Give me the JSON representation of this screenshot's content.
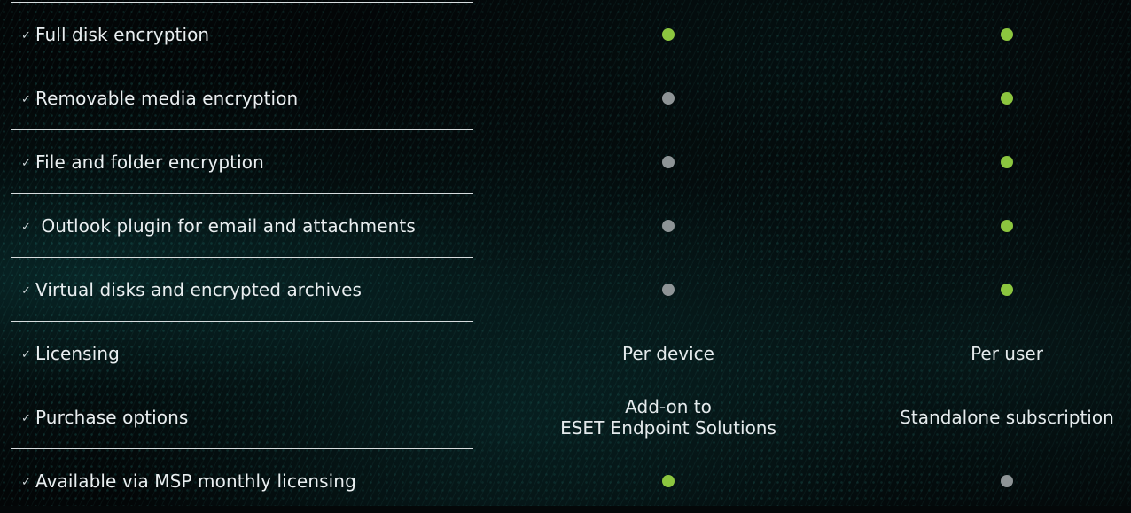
{
  "colors": {
    "included": "#8cc63f",
    "not_included": "#8e9496",
    "divider": "#d7dcde",
    "text": "#e9eef0"
  },
  "check_glyph": "✓",
  "rows": [
    {
      "feature": "Full disk encryption",
      "col1": {
        "type": "dot",
        "status": "included"
      },
      "col2": {
        "type": "dot",
        "status": "included"
      }
    },
    {
      "feature": "Removable media encryption",
      "col1": {
        "type": "dot",
        "status": "not_included"
      },
      "col2": {
        "type": "dot",
        "status": "included"
      }
    },
    {
      "feature": "File and folder encryption",
      "col1": {
        "type": "dot",
        "status": "not_included"
      },
      "col2": {
        "type": "dot",
        "status": "included"
      }
    },
    {
      "feature": " Outlook plugin for email and attachments",
      "col1": {
        "type": "dot",
        "status": "not_included"
      },
      "col2": {
        "type": "dot",
        "status": "included"
      }
    },
    {
      "feature": "Virtual disks and encrypted archives",
      "col1": {
        "type": "dot",
        "status": "not_included"
      },
      "col2": {
        "type": "dot",
        "status": "included"
      }
    },
    {
      "feature": "Licensing",
      "col1": {
        "type": "text",
        "lines": [
          "Per device"
        ]
      },
      "col2": {
        "type": "text",
        "lines": [
          "Per user"
        ]
      }
    },
    {
      "feature": "Purchase options",
      "col1": {
        "type": "text",
        "lines": [
          "Add-on to",
          "ESET Endpoint Solutions"
        ]
      },
      "col2": {
        "type": "text",
        "lines": [
          "Standalone subscription"
        ]
      }
    },
    {
      "feature": "Available via MSP monthly licensing",
      "col1": {
        "type": "dot",
        "status": "included"
      },
      "col2": {
        "type": "dot",
        "status": "not_included"
      }
    }
  ]
}
